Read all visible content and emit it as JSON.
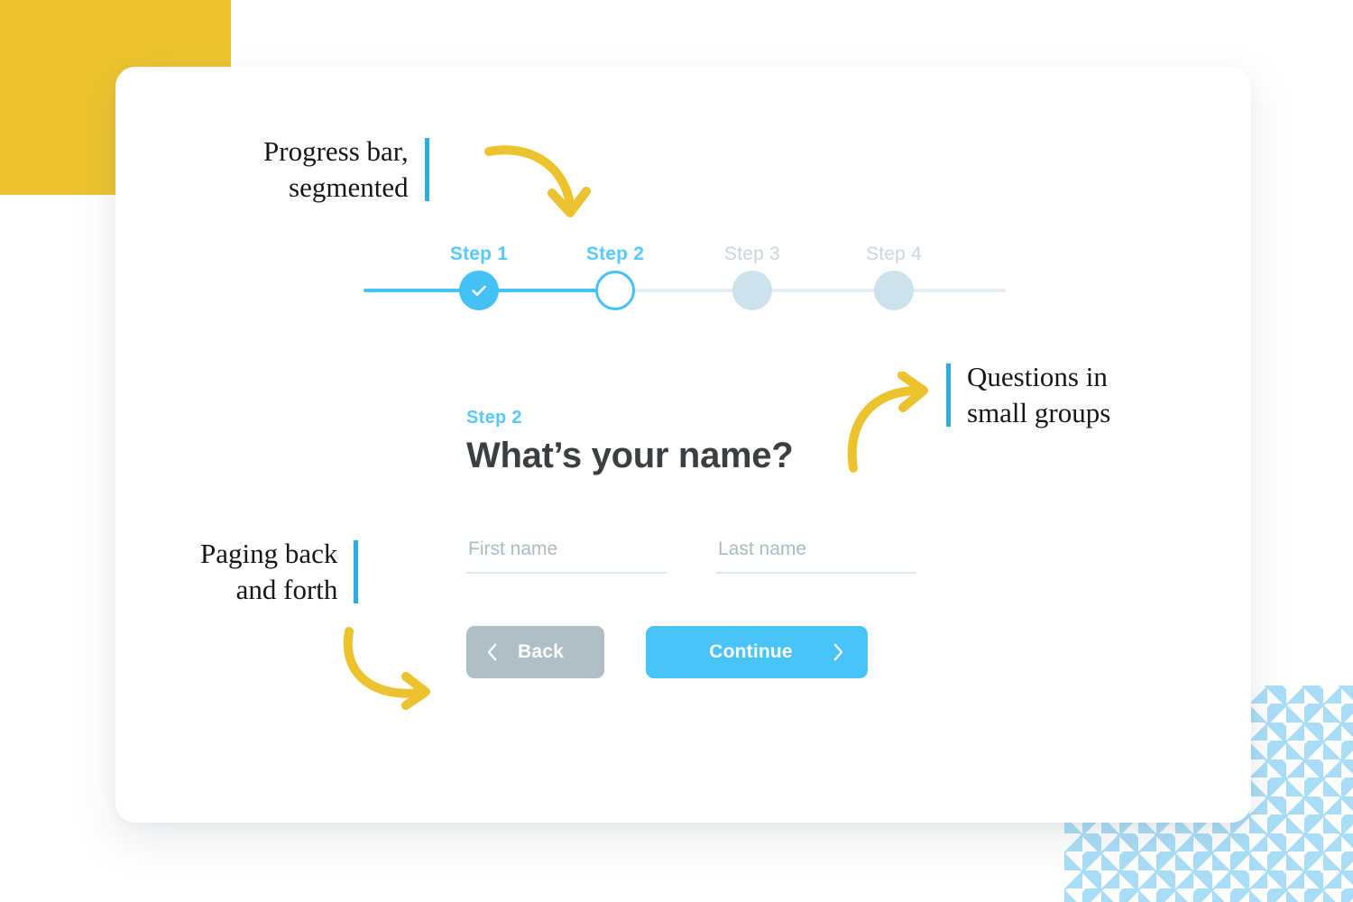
{
  "theme": {
    "accent_blue": "#44c1f5",
    "accent_blue_light": "#57cafb",
    "yellow": "#ecc32e",
    "annotation_bar_blue": "#2eade0",
    "muted_blue": "#cde2ea",
    "pattern_blue": "#a5dcf7",
    "back_button_gray": "#aebfc7",
    "heading_dark": "#3c3f42"
  },
  "progress": {
    "current_step": 2,
    "total_steps": 4,
    "steps": [
      {
        "label": "Step 1",
        "state": "done",
        "icon": "check-icon"
      },
      {
        "label": "Step 2",
        "state": "current",
        "icon": ""
      },
      {
        "label": "Step 3",
        "state": "upcoming",
        "icon": ""
      },
      {
        "label": "Step 4",
        "state": "upcoming",
        "icon": ""
      }
    ]
  },
  "form": {
    "eyebrow": "Step 2",
    "headline": "What’s your name?",
    "fields": [
      {
        "name": "first-name",
        "placeholder": "First name",
        "value": ""
      },
      {
        "name": "last-name",
        "placeholder": "Last name",
        "value": ""
      }
    ],
    "buttons": {
      "back": {
        "label": "Back",
        "icon": "chevron-left-icon"
      },
      "continue": {
        "label": "Continue",
        "icon": "chevron-right-icon"
      }
    }
  },
  "annotations": [
    {
      "id": "progress",
      "text": "Progress bar,\nsegmented",
      "bar_side": "right",
      "arrow": "curved-arrow-down-right"
    },
    {
      "id": "questions",
      "text": "Questions in\nsmall groups",
      "bar_side": "left",
      "arrow": "curved-arrow-up-right"
    },
    {
      "id": "paging",
      "text": "Paging back\nand forth",
      "bar_side": "right",
      "arrow": "curved-arrow-down-right"
    }
  ]
}
